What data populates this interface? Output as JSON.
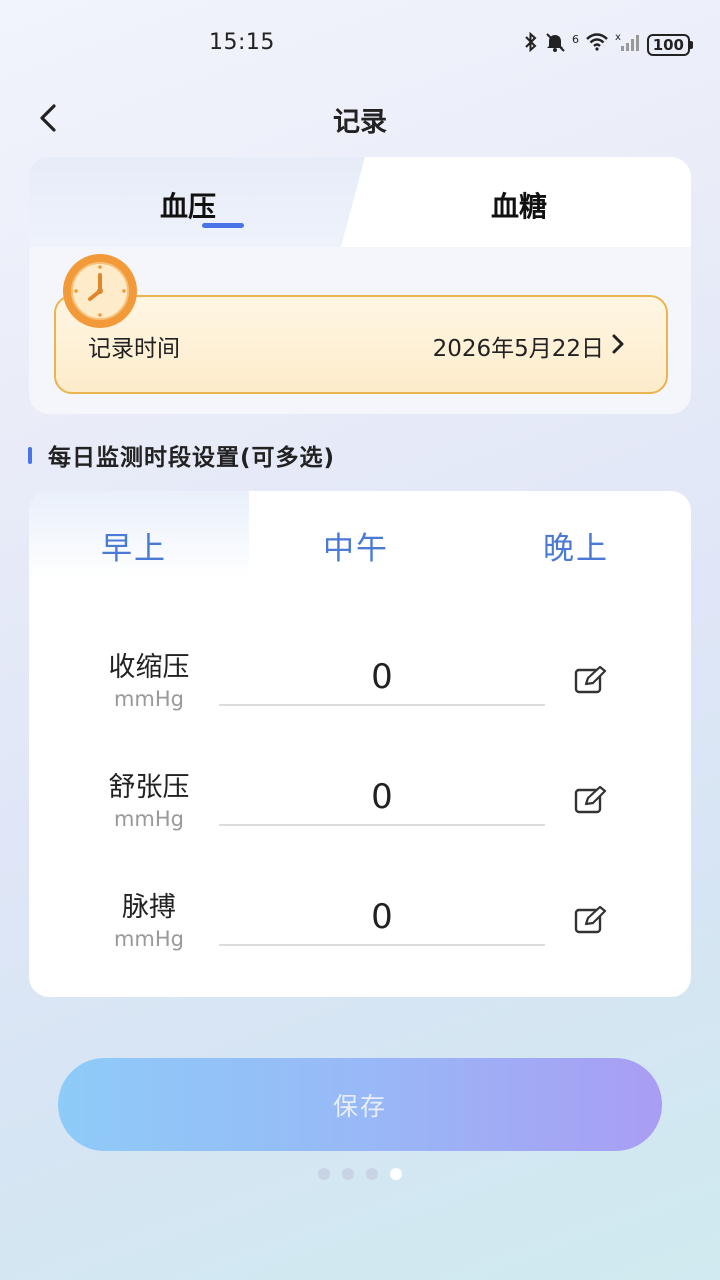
{
  "status_bar": {
    "time": "15:15",
    "network": "6",
    "battery": "100"
  },
  "header": {
    "title": "记录"
  },
  "tabs": [
    {
      "label": "血压",
      "active": true
    },
    {
      "label": "血糖",
      "active": false
    }
  ],
  "record_time": {
    "label": "记录时间",
    "value": "2026年5月22日"
  },
  "section": {
    "title": "每日监测时段设置(可多选)"
  },
  "periods": [
    {
      "label": "早上",
      "selected": true
    },
    {
      "label": "中午",
      "selected": false
    },
    {
      "label": "晚上",
      "selected": false
    }
  ],
  "measurements": [
    {
      "label": "收缩压",
      "unit": "mmHg",
      "value": "0"
    },
    {
      "label": "舒张压",
      "unit": "mmHg",
      "value": "0"
    },
    {
      "label": "脉搏",
      "unit": "mmHg",
      "value": "0"
    }
  ],
  "save_button": {
    "label": "保存"
  },
  "pager": {
    "count": 4,
    "active_index": 3
  },
  "colors": {
    "accent": "#4b73e8",
    "period_text": "#4a79d6",
    "record_border": "#eab44f",
    "clock": "#f0a040"
  }
}
